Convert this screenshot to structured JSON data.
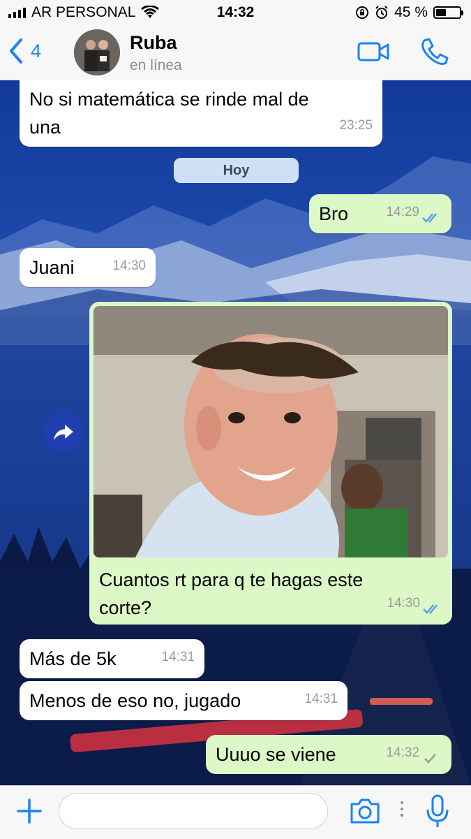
{
  "status_bar": {
    "carrier": "AR PERSONAL",
    "time": "14:32",
    "battery_percent": "45 %",
    "battery_level": 0.45
  },
  "header": {
    "back_count": "4",
    "contact_name": "Ruba",
    "contact_status": "en línea",
    "icons": [
      "chevron-left-icon",
      "video-call-icon",
      "phone-icon"
    ]
  },
  "chat": {
    "date_separator": "Hoy",
    "messages": [
      {
        "direction": "in",
        "text_line1": "No si matemática se rinde mal de",
        "text_line2": "una",
        "time": "23:25"
      },
      {
        "direction": "out",
        "text": "Bro",
        "time": "14:29",
        "status": "read"
      },
      {
        "direction": "in",
        "text": "Juani",
        "time": "14:30"
      },
      {
        "direction": "out",
        "type": "photo",
        "caption_line1": "Cuantos rt para q te hagas este",
        "caption_line2": "corte?",
        "time": "14:30",
        "status": "read"
      },
      {
        "direction": "in",
        "text": "Más de 5k",
        "time": "14:31"
      },
      {
        "direction": "in",
        "text": "Menos de eso no, jugado",
        "time": "14:31"
      },
      {
        "direction": "out",
        "text": "Uuuo se viene",
        "time": "14:32",
        "status": "sent"
      }
    ]
  },
  "input_bar": {
    "placeholder": "",
    "icons": [
      "plus-icon",
      "camera-icon",
      "microphone-icon"
    ]
  },
  "colors": {
    "accent": "#1b82f7",
    "outgoing_bubble": "#dcf8c6",
    "incoming_bubble": "#ffffff",
    "read_ticks": "#4fa3e8"
  }
}
